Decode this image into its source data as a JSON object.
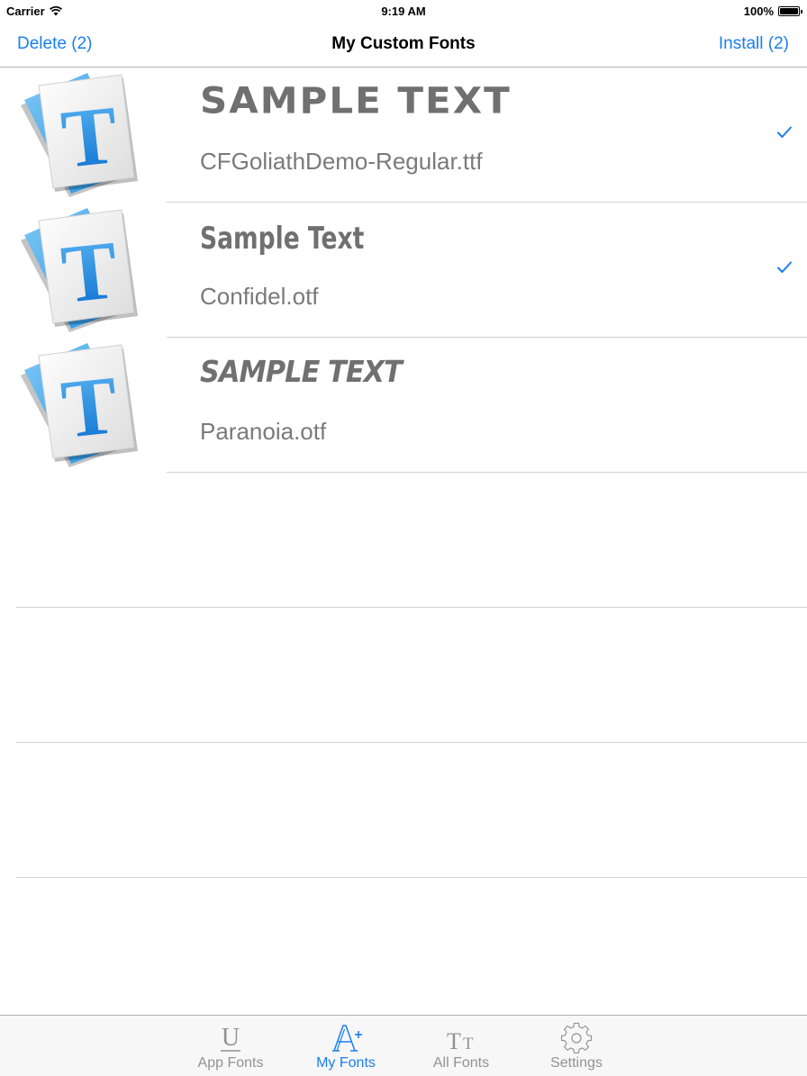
{
  "status_bar": {
    "carrier": "Carrier",
    "time": "9:19 AM",
    "battery": "100%"
  },
  "nav": {
    "left_button": "Delete (2)",
    "title": "My Custom Fonts",
    "right_button": "Install (2)"
  },
  "fonts": [
    {
      "sample": "SAMPLE TEXT",
      "filename": "CFGoliathDemo-Regular.ttf",
      "checked": true
    },
    {
      "sample": "Sample Text",
      "filename": "Confidel.otf",
      "checked": true
    },
    {
      "sample": "SAMPLE TEXT",
      "filename": "Paranoia.otf",
      "checked": false
    }
  ],
  "tabs": [
    {
      "label": "App Fonts",
      "icon": "underline-u-icon",
      "active": false
    },
    {
      "label": "My Fonts",
      "icon": "font-add-icon",
      "active": true
    },
    {
      "label": "All Fonts",
      "icon": "font-size-tt-icon",
      "active": false
    },
    {
      "label": "Settings",
      "icon": "gear-icon",
      "active": false
    }
  ],
  "colors": {
    "accent": "#1a7ef0",
    "text_gray": "#707070",
    "tab_inactive": "#929292"
  }
}
